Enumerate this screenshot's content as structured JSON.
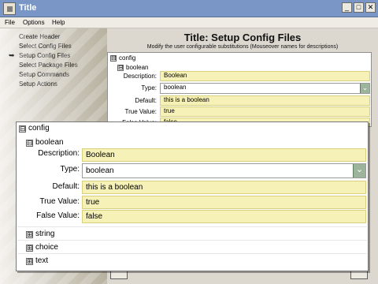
{
  "window": {
    "title": "Title",
    "controls": {
      "minimize": "_",
      "maximize": "□",
      "close": "✕"
    }
  },
  "menu": {
    "items": [
      "File",
      "Options",
      "Help"
    ]
  },
  "wizard": {
    "steps": [
      "Create Header",
      "Select Config Files",
      "Setup Config Files",
      "Select Package Files",
      "Setup Commands",
      "Setup Actions"
    ],
    "current_marker": "➥"
  },
  "main": {
    "title": "Title: Setup Config Files",
    "subtitle": "Modify the user configurable substitutions (Mouseover names for descriptions)"
  },
  "editor_small": {
    "root": "config",
    "node": "boolean",
    "fields": {
      "description_label": "Description:",
      "description_value": "Boolean",
      "type_label": "Type:",
      "type_value": "boolean",
      "default_label": "Default:",
      "default_value": "this is a boolean",
      "true_label": "True Value:",
      "true_value": "true",
      "false_label": "False Value:",
      "false_value": "false"
    }
  },
  "editor_large": {
    "root": "config",
    "node": "boolean",
    "fields": {
      "description_label": "Description:",
      "description_value": "Boolean",
      "type_label": "Type:",
      "type_value": "boolean",
      "default_label": "Default:",
      "default_value": "this is a boolean",
      "true_label": "True Value:",
      "true_value": "true",
      "false_label": "False Value:",
      "false_value": "false"
    },
    "other_nodes": [
      "string",
      "choice",
      "text"
    ],
    "expand_symbol": "⊞",
    "collapse_symbol": "⊟",
    "dropdown_symbol": "⌄"
  },
  "colors": {
    "titlebar": "#7a96c7",
    "field_fill": "#f6f1b6",
    "field_border": "#d9d07d",
    "dropdown_button": "#9cb49c"
  }
}
